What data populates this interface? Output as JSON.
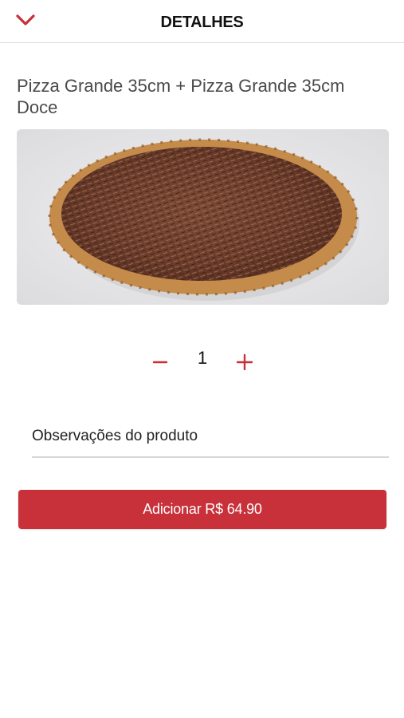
{
  "colors": {
    "accent": "#c8303a",
    "divider": "#dcdcdc"
  },
  "header": {
    "title": "DETALHES",
    "back_icon": "chevron-down-icon"
  },
  "product": {
    "title": "Pizza Grande 35cm + Pizza Grande 35cm Doce",
    "image_icon": "pizza-image"
  },
  "quantity": {
    "value": "1",
    "minus_icon": "minus-icon",
    "plus_icon": "plus-icon"
  },
  "observations": {
    "placeholder": "Observações do produto"
  },
  "cart": {
    "add_label": "Adicionar R$ 64.90"
  }
}
